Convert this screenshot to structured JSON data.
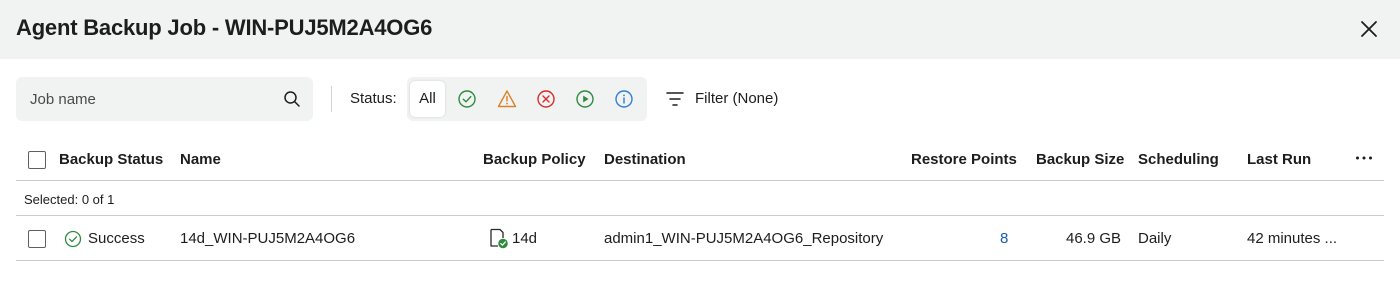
{
  "dialog": {
    "title": "Agent Backup Job - WIN-PUJ5M2A4OG6",
    "close_icon": "close-icon"
  },
  "toolbar": {
    "search_placeholder": "Job name",
    "search_icon": "search-icon",
    "status_label": "Status:",
    "status_filters": [
      {
        "label": "All",
        "selected": true
      },
      {
        "icon": "success-check-icon",
        "color": "#2e8b3d"
      },
      {
        "icon": "warning-icon",
        "color": "#d9822b"
      },
      {
        "icon": "error-x-icon",
        "color": "#d62c2c"
      },
      {
        "icon": "running-play-icon",
        "color": "#2e8b3d"
      },
      {
        "icon": "info-icon",
        "color": "#2f7ed8"
      }
    ],
    "filter_label": "Filter (None)",
    "filter_icon": "filter-lines-icon"
  },
  "table": {
    "columns": [
      "Backup Status",
      "Name",
      "Backup Policy",
      "Destination",
      "Restore Points",
      "Backup Size",
      "Scheduling",
      "Last Run"
    ],
    "selection_text": "Selected: 0 of 1",
    "rows": [
      {
        "status": "Success",
        "name": "14d_WIN-PUJ5M2A4OG6",
        "policy": "14d",
        "destination": "admin1_WIN-PUJ5M2A4OG6_Repository",
        "restore_points": "8",
        "backup_size": "46.9 GB",
        "scheduling": "Daily",
        "last_run": "42 minutes ..."
      }
    ]
  },
  "colors": {
    "header_bg": "#f1f3f3",
    "link": "#1a5fa8",
    "success": "#2e8b3d"
  }
}
